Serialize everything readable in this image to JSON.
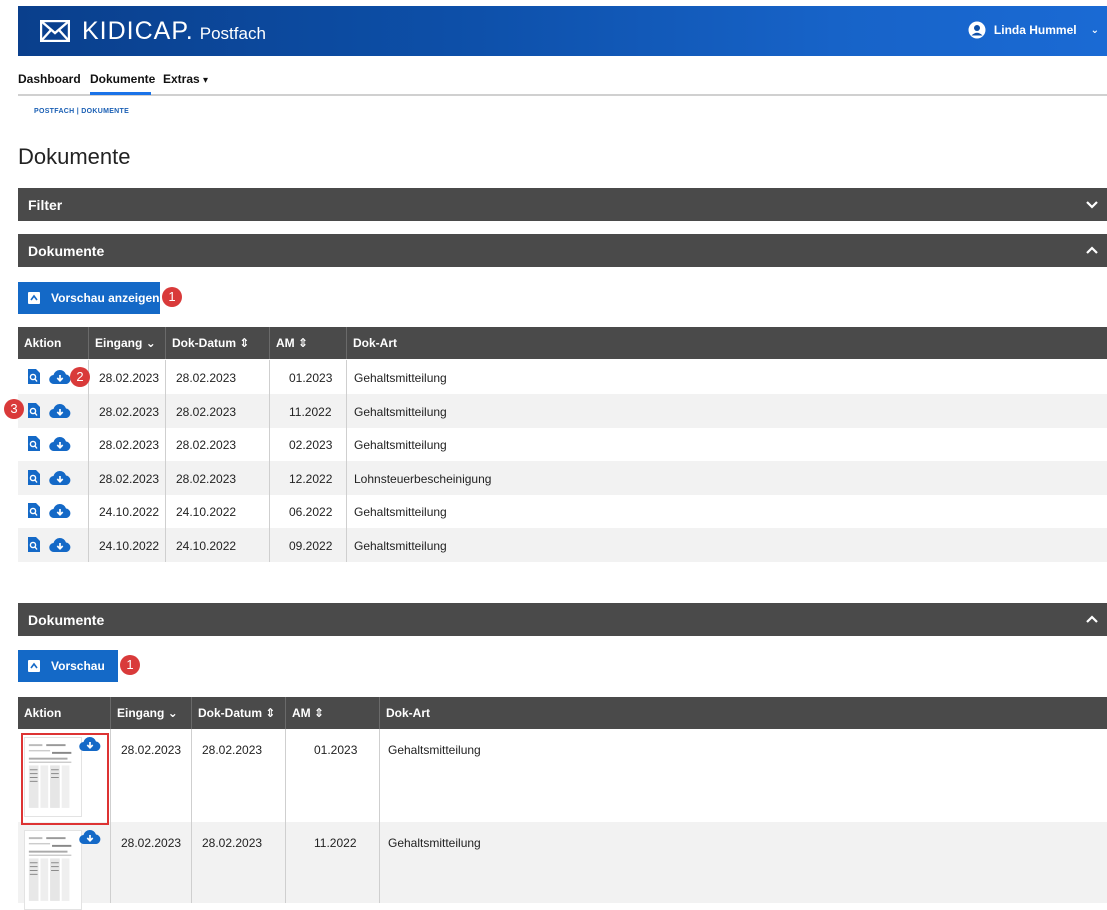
{
  "header": {
    "brand": "KIDICAP.",
    "brand_sub": "Postfach",
    "user_name": "Linda Hummel"
  },
  "nav": {
    "items": [
      "Dashboard",
      "Dokumente",
      "Extras"
    ],
    "active": "Dokumente"
  },
  "breadcrumb": "POSTFACH | DOKUMENTE",
  "page_title": "Dokumente",
  "panels": {
    "filter": "Filter",
    "docs_top": "Dokumente",
    "docs_bottom": "Dokumente"
  },
  "buttons": {
    "preview_show": "Vorschau anzeigen",
    "preview": "Vorschau"
  },
  "badges": [
    "1",
    "2",
    "3",
    "1"
  ],
  "table": {
    "columns": [
      "Aktion",
      "Eingang",
      "Dok-Datum",
      "AM",
      "Dok-Art"
    ],
    "sort_indicators": [
      "",
      "⌄",
      "⇕",
      "⇕",
      ""
    ],
    "rows": [
      [
        "28.02.2023",
        "28.02.2023",
        "01.2023",
        "Gehaltsmitteilung"
      ],
      [
        "28.02.2023",
        "28.02.2023",
        "11.2022",
        "Gehaltsmitteilung"
      ],
      [
        "28.02.2023",
        "28.02.2023",
        "02.2023",
        "Gehaltsmitteilung"
      ],
      [
        "28.02.2023",
        "28.02.2023",
        "12.2022",
        "Lohnsteuerbescheinigung"
      ],
      [
        "24.10.2022",
        "24.10.2022",
        "06.2022",
        "Gehaltsmitteilung"
      ],
      [
        "24.10.2022",
        "24.10.2022",
        "09.2022",
        "Gehaltsmitteilung"
      ]
    ]
  },
  "table2": {
    "rows": [
      [
        "28.02.2023",
        "28.02.2023",
        "01.2023",
        "Gehaltsmitteilung"
      ],
      [
        "28.02.2023",
        "28.02.2023",
        "11.2022",
        "Gehaltsmitteilung"
      ]
    ]
  },
  "colors": {
    "header": "#0d4fa8",
    "accent": "#1469c7",
    "bar": "#4a4a4a",
    "badge": "#d93a3a"
  }
}
